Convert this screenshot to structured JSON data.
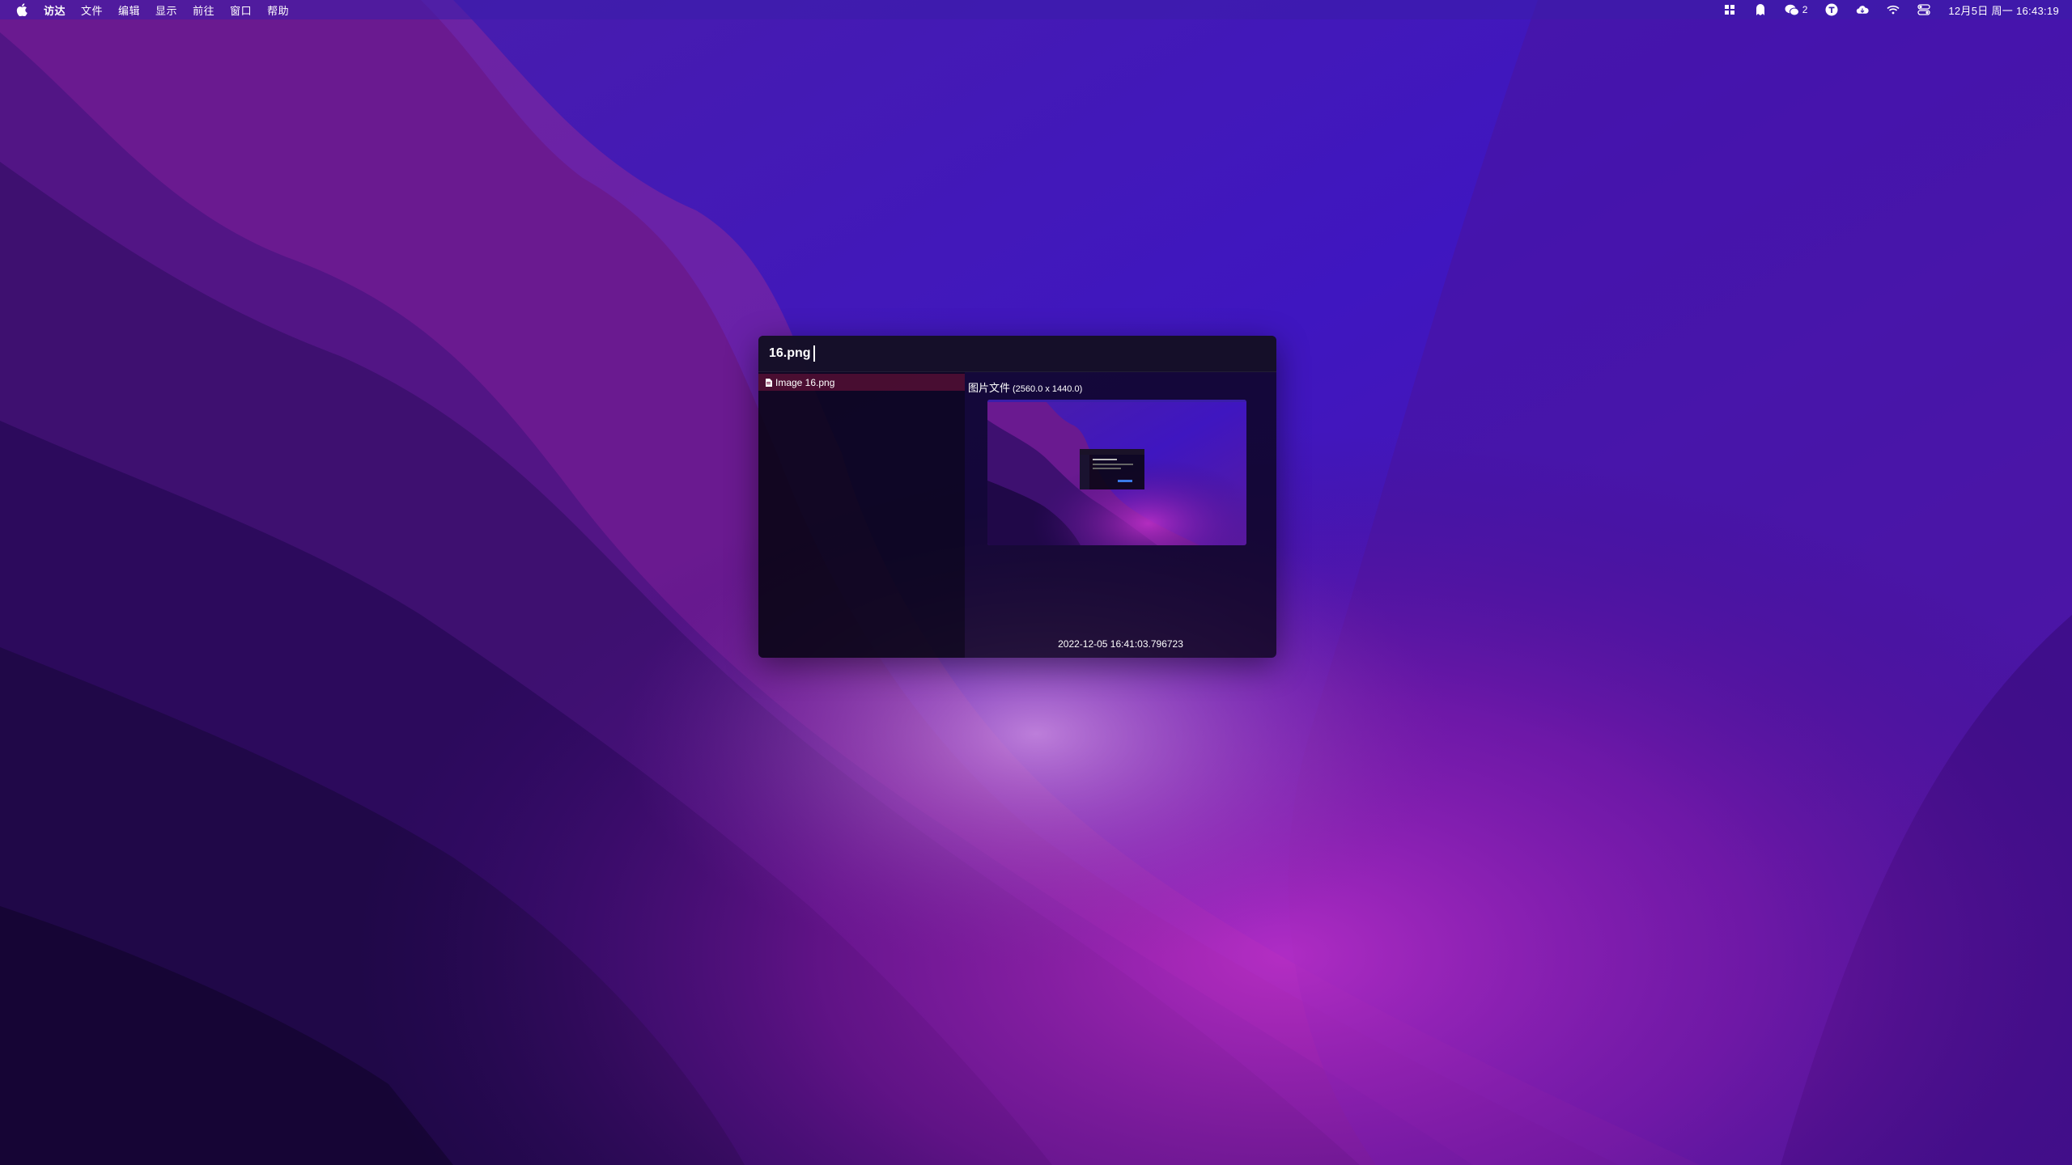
{
  "menubar": {
    "app_name": "访达",
    "menus": [
      "文件",
      "编辑",
      "显示",
      "前往",
      "窗口",
      "帮助"
    ],
    "wechat_count": "2",
    "clock": "12月5日 周一  16:43:19"
  },
  "launcher": {
    "query": "16.png",
    "results": [
      {
        "label": "Image 16.png"
      }
    ],
    "preview": {
      "type_label": "图片文件",
      "dimensions": "(2560.0 x 1440.0)",
      "timestamp": "2022-12-05 16:41:03.796723"
    }
  },
  "colors": {
    "accent": "#7a1440",
    "menubar": "#3a1eaa"
  },
  "icons": [
    "apple-icon",
    "grid-icon",
    "ghost-icon",
    "wechat-icon",
    "t-icon",
    "cloud-icon",
    "wifi-icon",
    "control-center-icon",
    "file-icon"
  ]
}
